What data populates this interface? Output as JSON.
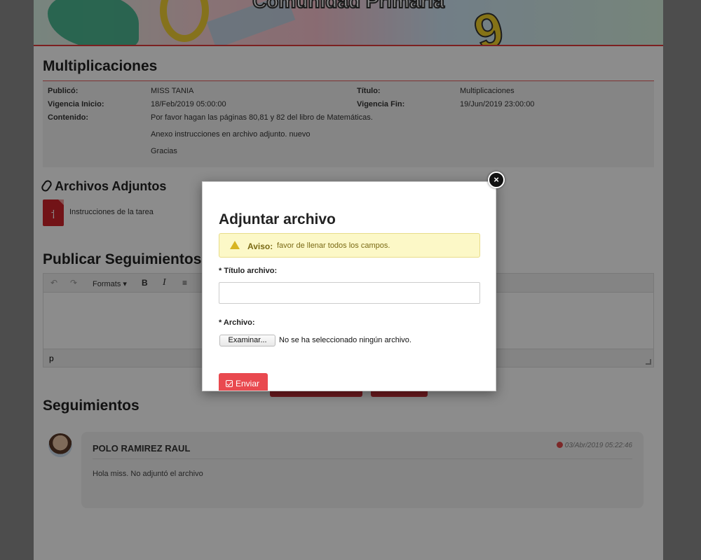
{
  "banner": {
    "title": "Comunidad Primaria"
  },
  "task": {
    "heading": "Multiplicaciones",
    "published_by_label": "Publicó:",
    "published_by": "MISS TANIA",
    "title_label": "Título:",
    "title": "Multiplicaciones",
    "start_label": "Vigencia Inicio:",
    "start": "18/Feb/2019 05:00:00",
    "end_label": "Vigencia Fin:",
    "end": "19/Jun/2019 23:00:00",
    "content_label": "Contenido:",
    "content_lines": [
      "Por favor hagan las páginas 80,81 y 82 del libro de Matemáticas.",
      "Anexo instrucciones en archivo adjunto. nuevo",
      "Gracias"
    ]
  },
  "attachments": {
    "heading": "Archivos Adjuntos",
    "icon": "paperclip-icon",
    "items": [
      {
        "label": "Instrucciones de la tarea",
        "icon": "pdf-icon"
      }
    ]
  },
  "publish": {
    "heading": "Publicar Seguimientos",
    "toolbar": {
      "formats_label": "Formats",
      "bold": "B",
      "italic": "I"
    },
    "status_path": "p"
  },
  "followups": {
    "heading": "Seguimientos",
    "items": [
      {
        "author": "POLO RAMIREZ RAUL",
        "date": "03/Abr/2019 05:22:46",
        "text": "Hola miss. No adjuntó el archivo"
      }
    ]
  },
  "modal": {
    "title": "Adjuntar archivo",
    "alert_strong": "Aviso:",
    "alert_message": "favor de llenar todos los campos.",
    "title_field_label": "* Título archivo:",
    "title_field_value": "",
    "file_field_label": "* Archivo:",
    "browse_label": "Examinar...",
    "no_file_text": "No se ha seleccionado ningún archivo.",
    "submit_label": "Enviar",
    "close_label": "×"
  },
  "colors": {
    "accent": "#e9494f",
    "alert_bg": "#fcf8c7",
    "banner_border": "#e23b3b"
  }
}
